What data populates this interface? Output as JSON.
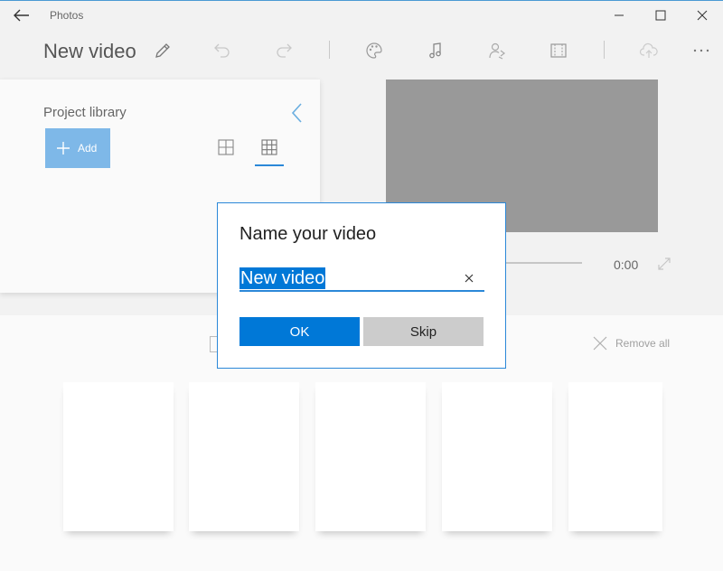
{
  "window": {
    "app_title": "Photos"
  },
  "toolbar": {
    "project_title": "New video",
    "icons": [
      "edit-icon",
      "undo-icon",
      "redo-icon",
      "theme-icon",
      "music-icon",
      "narration-icon",
      "aspect-ratio-icon",
      "export-icon",
      "more-icon"
    ]
  },
  "library": {
    "title": "Project library",
    "add_label": "Add"
  },
  "player": {
    "time": "0:00"
  },
  "storyboard": {
    "remove_all_label": "Remove all",
    "card_count": 5
  },
  "dialog": {
    "title": "Name your video",
    "name_value": "New video",
    "ok_label": "OK",
    "skip_label": "Skip"
  },
  "colors": {
    "accent": "#0078d7",
    "add_button": "#7eb8e8",
    "preview_bg": "#999999",
    "secondary_button": "#cccccc"
  }
}
